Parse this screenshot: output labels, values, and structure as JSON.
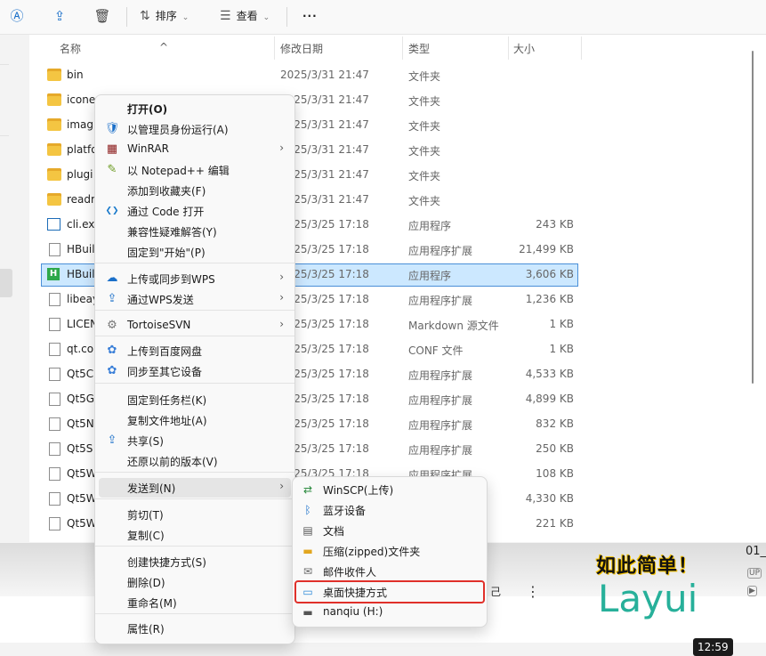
{
  "toolbar": {
    "sort_label": "排序",
    "view_label": "查看",
    "more_label": "···"
  },
  "columns": {
    "name": "名称",
    "date": "修改日期",
    "type": "类型",
    "size": "大小"
  },
  "files": [
    {
      "name": "bin",
      "date": "2025/3/31 21:47",
      "type": "文件夹",
      "size": "",
      "icon": "folder"
    },
    {
      "name": "icone",
      "date": "2025/3/31 21:47",
      "type": "文件夹",
      "size": "",
      "icon": "folder"
    },
    {
      "name": "imag",
      "date": "2025/3/31 21:47",
      "type": "文件夹",
      "size": "",
      "icon": "folder"
    },
    {
      "name": "platfo",
      "date": "2025/3/31 21:47",
      "type": "文件夹",
      "size": "",
      "icon": "folder"
    },
    {
      "name": "plugi",
      "date": "2025/3/31 21:47",
      "type": "文件夹",
      "size": "",
      "icon": "folder"
    },
    {
      "name": "readr",
      "date": "2025/3/31 21:47",
      "type": "文件夹",
      "size": "",
      "icon": "folder"
    },
    {
      "name": "cli.exe",
      "date": "2025/3/25 17:18",
      "type": "应用程序",
      "size": "243 KB",
      "icon": "exe"
    },
    {
      "name": "HBuil",
      "date": "2025/3/25 17:18",
      "type": "应用程序扩展",
      "size": "21,499 KB",
      "icon": "dll"
    },
    {
      "name": "HBuil",
      "date": "2025/3/25 17:18",
      "type": "应用程序",
      "size": "3,606 KB",
      "icon": "hbx"
    },
    {
      "name": "libeay",
      "date": "2025/3/25 17:18",
      "type": "应用程序扩展",
      "size": "1,236 KB",
      "icon": "dll"
    },
    {
      "name": "LICEN",
      "date": "2025/3/25 17:18",
      "type": "Markdown 源文件",
      "size": "1 KB",
      "icon": "doc"
    },
    {
      "name": "qt.co",
      "date": "2025/3/25 17:18",
      "type": "CONF 文件",
      "size": "1 KB",
      "icon": "doc"
    },
    {
      "name": "Qt5C",
      "date": "2025/3/25 17:18",
      "type": "应用程序扩展",
      "size": "4,533 KB",
      "icon": "dll"
    },
    {
      "name": "Qt5G",
      "date": "2025/3/25 17:18",
      "type": "应用程序扩展",
      "size": "4,899 KB",
      "icon": "dll"
    },
    {
      "name": "Qt5N",
      "date": "2025/3/25 17:18",
      "type": "应用程序扩展",
      "size": "832 KB",
      "icon": "dll"
    },
    {
      "name": "Qt5S",
      "date": "2025/3/25 17:18",
      "type": "应用程序扩展",
      "size": "250 KB",
      "icon": "dll"
    },
    {
      "name": "Qt5W",
      "date": "2025/3/25 17:18",
      "type": "应用程序扩展",
      "size": "108 KB",
      "icon": "dll"
    },
    {
      "name": "Qt5W",
      "date": "",
      "type": "",
      "size": "4,330 KB",
      "icon": "dll"
    },
    {
      "name": "Qt5W",
      "date": "",
      "type": "",
      "size": "221 KB",
      "icon": "dll"
    }
  ],
  "context_menu": {
    "items": [
      {
        "label": "打开(O)",
        "icon": "none",
        "bold": true
      },
      {
        "label": "以管理员身份运行(A)",
        "icon": "shield-icon"
      },
      {
        "label": "WinRAR",
        "icon": "winrar-icon",
        "submenu": true
      },
      {
        "label": "以 Notepad++ 编辑",
        "icon": "notepad-icon"
      },
      {
        "label": "添加到收藏夹(F)",
        "icon": "none"
      },
      {
        "label": "通过 Code 打开",
        "icon": "vscode-icon"
      },
      {
        "label": "兼容性疑难解答(Y)",
        "icon": "none"
      },
      {
        "label": "固定到\"开始\"(P)",
        "icon": "none"
      },
      {
        "label": "上传或同步到WPS",
        "icon": "cloud-icon",
        "submenu": true
      },
      {
        "label": "通过WPS发送",
        "icon": "share-icon",
        "submenu": true
      },
      {
        "label": "TortoiseSVN",
        "icon": "tortoise-icon",
        "submenu": true
      },
      {
        "label": "上传到百度网盘",
        "icon": "baidu-icon"
      },
      {
        "label": "同步至其它设备",
        "icon": "baidu-icon"
      },
      {
        "label": "固定到任务栏(K)",
        "icon": "none"
      },
      {
        "label": "复制文件地址(A)",
        "icon": "none"
      },
      {
        "label": "共享(S)",
        "icon": "share-icon"
      },
      {
        "label": "还原以前的版本(V)",
        "icon": "none"
      },
      {
        "label": "发送到(N)",
        "icon": "none",
        "submenu": true
      },
      {
        "label": "剪切(T)",
        "icon": "none"
      },
      {
        "label": "复制(C)",
        "icon": "none"
      },
      {
        "label": "创建快捷方式(S)",
        "icon": "none"
      },
      {
        "label": "删除(D)",
        "icon": "none"
      },
      {
        "label": "重命名(M)",
        "icon": "none"
      },
      {
        "label": "属性(R)",
        "icon": "none"
      }
    ]
  },
  "send_to_menu": {
    "items": [
      {
        "label": "WinSCP(上传)",
        "icon": "winscp-icon"
      },
      {
        "label": "蓝牙设备",
        "icon": "bluetooth-icon"
      },
      {
        "label": "文档",
        "icon": "document-icon"
      },
      {
        "label": "压缩(zipped)文件夹",
        "icon": "zip-folder-icon"
      },
      {
        "label": "邮件收件人",
        "icon": "mail-icon"
      },
      {
        "label": "桌面快捷方式",
        "icon": "desktop-icon",
        "highlighted": true
      },
      {
        "label": "nanqiu (H:)",
        "icon": "drive-icon"
      }
    ]
  },
  "video": {
    "promo_line1": "如此简单！",
    "promo_line2": "Layui",
    "duration": "12:59",
    "title_fragment": "01_",
    "side_text": "己"
  },
  "colors": {
    "selection_bg": "#cce8ff",
    "highlight_box": "#e0302a",
    "accent": "#1a6fc9"
  }
}
